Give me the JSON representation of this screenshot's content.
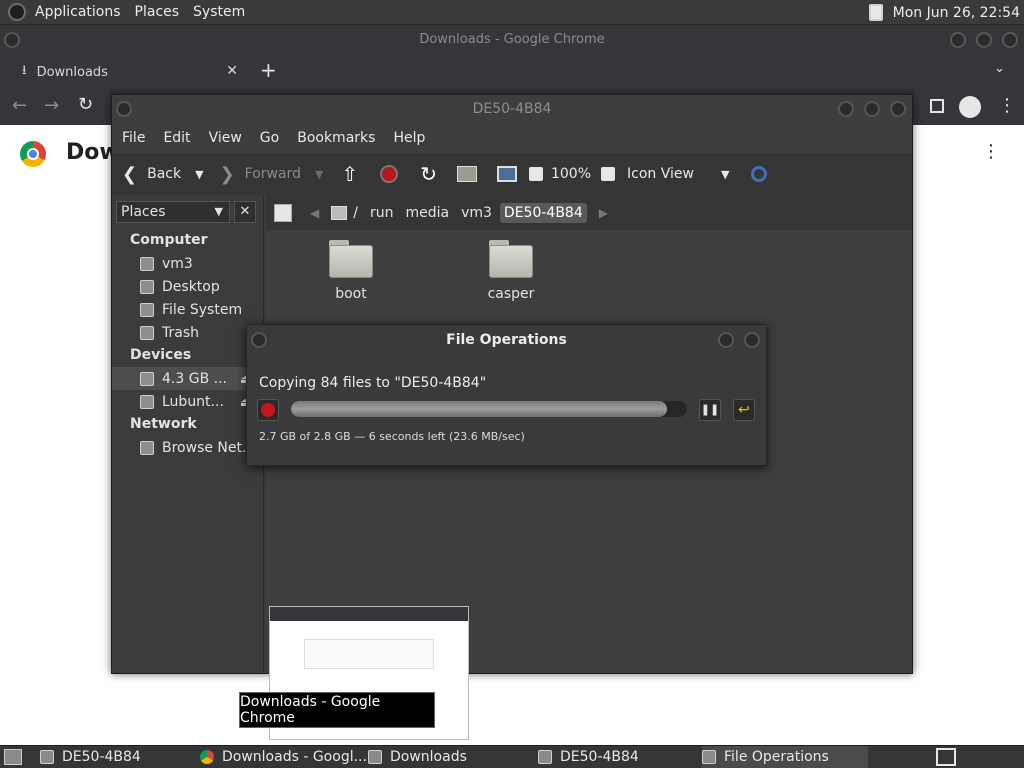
{
  "top_panel": {
    "menus": [
      "Applications",
      "Places",
      "System"
    ],
    "clock": "Mon Jun 26, 22:54"
  },
  "chrome": {
    "window_title": "Downloads - Google Chrome",
    "tab_title": "Downloads",
    "page_heading": "Dow"
  },
  "file_manager": {
    "window_title": "DE50-4B84",
    "menus": [
      "File",
      "Edit",
      "View",
      "Go",
      "Bookmarks",
      "Help"
    ],
    "toolbar": {
      "back": "Back",
      "forward": "Forward",
      "zoom": "100%",
      "view_mode": "Icon View"
    },
    "sidebar": {
      "selector": "Places",
      "sections": [
        {
          "title": "Computer",
          "items": [
            "vm3",
            "Desktop",
            "File System",
            "Trash"
          ]
        },
        {
          "title": "Devices",
          "items": [
            "4.3 GB ...",
            "Lubunt..."
          ]
        },
        {
          "title": "Network",
          "items": [
            "Browse Net..."
          ]
        }
      ]
    },
    "path": [
      "/",
      "run",
      "media",
      "vm3",
      "DE50-4B84"
    ],
    "files": [
      "boot",
      "casper"
    ]
  },
  "file_operations": {
    "title": "File Operations",
    "message": "Copying 84 files to \"DE50-4B84\"",
    "progress": 0.95,
    "status": "2.7 GB of 2.8 GB — 6 seconds left (23.6 MB/sec)"
  },
  "tooltip": "Downloads - Google Chrome",
  "taskbar": {
    "tasks": [
      "DE50-4B84",
      "Downloads - Googl...",
      "Downloads",
      "DE50-4B84",
      "File Operations"
    ]
  },
  "colors": {
    "accent_red": "#c4161c",
    "chrome_toolbar": "#35363a",
    "panel": "#3a3a3a"
  }
}
